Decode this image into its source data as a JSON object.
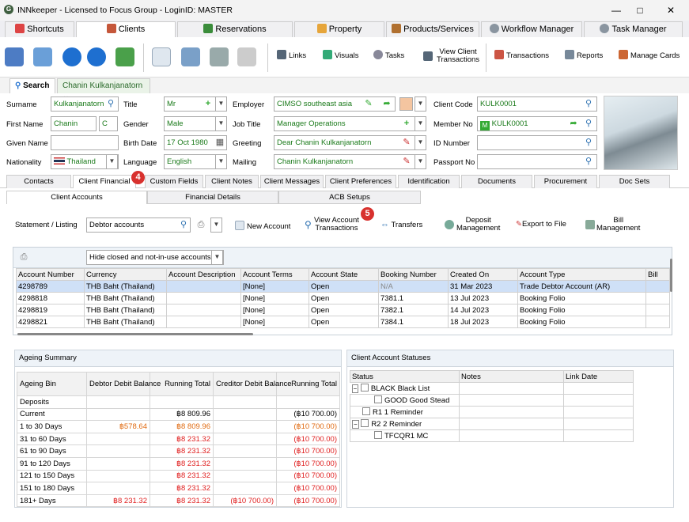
{
  "window": {
    "title": "INNkeeper - Licensed to Focus Group - LoginID: MASTER"
  },
  "main_tabs": [
    "Shortcuts",
    "Clients",
    "Reservations",
    "Property",
    "Products/Services",
    "Workflow Manager",
    "Task Manager"
  ],
  "toolbar": {
    "links": "Links",
    "visuals": "Visuals",
    "tasks": "Tasks",
    "view_client_1": "View Client",
    "view_client_2": "Transactions",
    "transactions": "Transactions",
    "reports": "Reports",
    "manage_cards": "Manage Cards"
  },
  "search_tabs": {
    "search": "Search",
    "client": "Chanin Kulkanjanatorn"
  },
  "form": {
    "surname_label": "Surname",
    "surname": "Kulkanjanatorn",
    "title_label": "Title",
    "title": "Mr",
    "employer_label": "Employer",
    "employer": "CIMSO southeast asia",
    "client_code_label": "Client Code",
    "client_code": "KULK0001",
    "first_name_label": "First Name",
    "first_name": "Chanin",
    "middle_initial": "C",
    "gender_label": "Gender",
    "gender": "Male",
    "job_title_label": "Job Title",
    "job_title": "Manager Operations",
    "member_no_label": "Member No",
    "member_no": "KULK0001",
    "given_name_label": "Given Name",
    "given_name": "",
    "birth_date_label": "Birth Date",
    "birth_date": "17 Oct 1980",
    "greeting_label": "Greeting",
    "greeting": "Dear Chanin Kulkanjanatorn",
    "id_number_label": "ID Number",
    "id_number": "",
    "nationality_label": "Nationality",
    "nationality": "Thailand",
    "language_label": "Language",
    "language": "English",
    "mailing_label": "Mailing",
    "mailing": "Chanin Kulkanjanatorn",
    "passport_label": "Passport No",
    "passport": ""
  },
  "client_tabs": [
    "Contacts",
    "Client Financial",
    "Custom Fields",
    "Client Notes",
    "Client Messages",
    "Client Preferences",
    "Identification",
    "Documents",
    "Procurement",
    "Doc Sets"
  ],
  "badges": {
    "b4": "4",
    "b5": "5"
  },
  "sub_tabs": [
    "Client Accounts",
    "Financial Details",
    "ACB Setups"
  ],
  "actions": {
    "statement_label": "Statement / Listing",
    "statement_value": "Debtor accounts",
    "new_account": "New Account",
    "view_acc_1": "View Account",
    "view_acc_2": "Transactions",
    "transfers": "Transfers",
    "deposit_1": "Deposit",
    "deposit_2": "Management",
    "export": "Export to File",
    "bill_1": "Bill",
    "bill_2": "Management"
  },
  "filter": "Hide closed and not-in-use accounts",
  "accounts": {
    "headers": [
      "Account Number",
      "Currency",
      "Account Description",
      "Account Terms",
      "Account State",
      "Booking Number",
      "Created On",
      "Account Type",
      "Bill"
    ],
    "rows": [
      [
        "4298789",
        "THB Baht (Thailand)",
        "",
        "[None]",
        "Open",
        "N/A",
        "31 Mar 2023",
        "Trade Debtor Account (AR)",
        ""
      ],
      [
        "4298818",
        "THB Baht (Thailand)",
        "",
        "[None]",
        "Open",
        "7381.1",
        "13 Jul 2023",
        "Booking Folio",
        ""
      ],
      [
        "4298819",
        "THB Baht (Thailand)",
        "",
        "[None]",
        "Open",
        "7382.1",
        "14 Jul 2023",
        "Booking Folio",
        ""
      ],
      [
        "4298821",
        "THB Baht (Thailand)",
        "",
        "[None]",
        "Open",
        "7384.1",
        "18 Jul 2023",
        "Booking Folio",
        ""
      ]
    ]
  },
  "ageing": {
    "title": "Ageing Summary",
    "headers": [
      "Ageing Bin",
      "Debtor Debit Balance",
      "Running Total",
      "Creditor Debit Balance",
      "Running Total"
    ],
    "rows": [
      [
        "Deposits",
        "",
        "",
        "",
        ""
      ],
      [
        "Current",
        "",
        "฿8 809.96",
        "",
        "(฿10 700.00)"
      ],
      [
        "1 to 30 Days",
        "฿578.64",
        "฿8 809.96",
        "",
        "(฿10 700.00)"
      ],
      [
        "31 to 60 Days",
        "",
        "฿8 231.32",
        "",
        "(฿10 700.00)"
      ],
      [
        "61 to 90 Days",
        "",
        "฿8 231.32",
        "",
        "(฿10 700.00)"
      ],
      [
        "91 to 120 Days",
        "",
        "฿8 231.32",
        "",
        "(฿10 700.00)"
      ],
      [
        "121 to 150 Days",
        "",
        "฿8 231.32",
        "",
        "(฿10 700.00)"
      ],
      [
        "151 to 180 Days",
        "",
        "฿8 231.32",
        "",
        "(฿10 700.00)"
      ],
      [
        "181+ Days",
        "฿8 231.32",
        "฿8 231.32",
        "(฿10 700.00)",
        "(฿10 700.00)"
      ]
    ]
  },
  "statuses": {
    "title": "Client Account Statuses",
    "headers": [
      "Status",
      "Notes",
      "Link Date"
    ],
    "rows": [
      "BLACK Black List",
      "GOOD Good Stead",
      "R1 1 Reminder",
      "R2 2 Reminder",
      "TFCQR1 MC"
    ]
  },
  "colors": {
    "accent_red": "#d8312e",
    "selected_row": "#cfe0f7",
    "green_text": "#1a7a1a"
  }
}
